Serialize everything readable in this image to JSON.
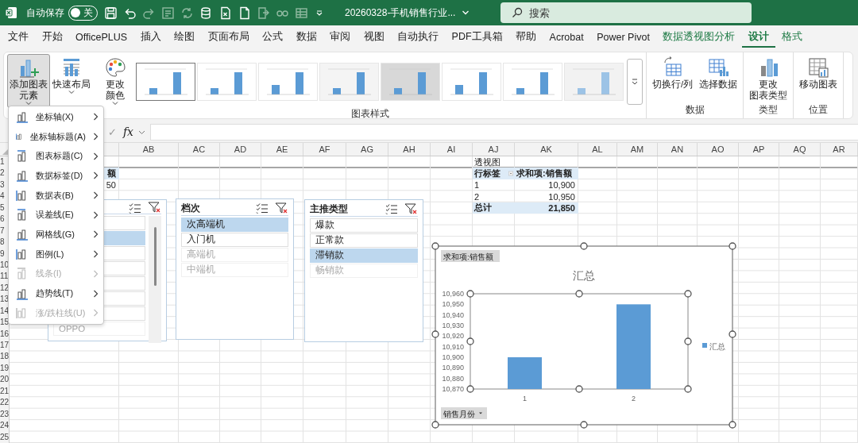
{
  "title_bar": {
    "autosave_label": "自动保存",
    "autosave": {
      "on": false,
      "label": "关"
    },
    "quick_access": [
      {
        "kind": "save",
        "disabled": false
      },
      {
        "kind": "undo",
        "disabled": false
      },
      {
        "kind": "redo",
        "disabled": true
      },
      {
        "kind": "form",
        "disabled": true
      },
      {
        "kind": "sync",
        "disabled": true
      },
      {
        "kind": "database",
        "disabled": false
      },
      {
        "kind": "spreadsheet",
        "disabled": false
      },
      {
        "kind": "file",
        "disabled": false
      },
      {
        "kind": "export",
        "disabled": true
      },
      {
        "kind": "link",
        "disabled": true
      },
      {
        "kind": "table",
        "disabled": true
      },
      {
        "kind": "customize",
        "disabled": false
      }
    ],
    "filename": "20260328-手机销售行业...",
    "search": {
      "placeholder": "搜索"
    }
  },
  "menu_tabs": [
    {
      "label": "文件",
      "selected": false,
      "contextual": false
    },
    {
      "label": "开始",
      "selected": false,
      "contextual": false
    },
    {
      "label": "OfficePLUS",
      "selected": false,
      "contextual": false
    },
    {
      "label": "插入",
      "selected": false,
      "contextual": false
    },
    {
      "label": "绘图",
      "selected": false,
      "contextual": false
    },
    {
      "label": "页面布局",
      "selected": false,
      "contextual": false
    },
    {
      "label": "公式",
      "selected": false,
      "contextual": false
    },
    {
      "label": "数据",
      "selected": false,
      "contextual": false
    },
    {
      "label": "审阅",
      "selected": false,
      "contextual": false
    },
    {
      "label": "视图",
      "selected": false,
      "contextual": false
    },
    {
      "label": "自动执行",
      "selected": false,
      "contextual": false
    },
    {
      "label": "PDF工具箱",
      "selected": false,
      "contextual": false
    },
    {
      "label": "帮助",
      "selected": false,
      "contextual": false
    },
    {
      "label": "Acrobat",
      "selected": false,
      "contextual": false
    },
    {
      "label": "Power Pivot",
      "selected": false,
      "contextual": false
    },
    {
      "label": "数据透视图分析",
      "selected": false,
      "contextual": true
    },
    {
      "label": "设计",
      "selected": true,
      "contextual": true
    },
    {
      "label": "格式",
      "selected": false,
      "contextual": true
    }
  ],
  "ribbon": {
    "layout_buttons": [
      {
        "lines": [
          "添加图表",
          "元素"
        ],
        "kind": "add-element",
        "dropdown": true,
        "pressed": true
      },
      {
        "lines": [
          "快速布局"
        ],
        "kind": "quick-layout",
        "dropdown": true,
        "pressed": false
      }
    ],
    "styles_group": {
      "label": "图表样式",
      "color_button": {
        "lines": [
          "更改",
          "颜色"
        ],
        "dropdown": true
      },
      "chart_styles": [
        {
          "selected": true
        },
        {
          "selected": false
        },
        {
          "selected": false
        },
        {
          "selected": false
        },
        {
          "selected": false
        },
        {
          "selected": false
        },
        {
          "selected": false
        },
        {
          "selected": false
        }
      ]
    },
    "groups": [
      {
        "label": "数据",
        "buttons": [
          {
            "lines": [
              "切换行/列"
            ],
            "kind": "switch"
          },
          {
            "lines": [
              "选择数据"
            ],
            "kind": "select-data"
          }
        ]
      },
      {
        "label": "类型",
        "buttons": [
          {
            "lines": [
              "更改",
              "图表类型"
            ],
            "kind": "change-type"
          }
        ]
      },
      {
        "label": "位置",
        "buttons": [
          {
            "lines": [
              "移动图表"
            ],
            "kind": "move-chart"
          }
        ]
      }
    ]
  },
  "formula_bar": {
    "enter": "✓",
    "function": "fx"
  },
  "sheet": {
    "columns": [
      "AB",
      "AC",
      "AD",
      "AE",
      "AF",
      "AG",
      "AH",
      "AI",
      "AJ",
      "AK",
      "AL",
      "AM",
      "AN",
      "AO",
      "AP",
      "AQ",
      "AR"
    ],
    "rows": [
      "1",
      "2",
      "3",
      "4",
      "5",
      "6",
      "7",
      "8",
      "9",
      "10",
      "11",
      "12",
      "13",
      "14",
      "15",
      "16",
      "17",
      "18",
      "19",
      "20",
      "21",
      "22",
      "23",
      "24",
      "25"
    ],
    "cut_cells": [
      {
        "text": "额",
        "kind": "header"
      },
      {
        "text": "50",
        "kind": "value"
      }
    ],
    "pivot_table": {
      "title": "透视图",
      "row_label": "行标签",
      "value_label": "求和项:销售额",
      "rows": [
        {
          "label": "1",
          "value": "10,900"
        },
        {
          "label": "2",
          "value": "10,950"
        }
      ],
      "total": {
        "label": "总计",
        "value": "21,850"
      }
    }
  },
  "slicers": [
    {
      "scrollbar": true,
      "items": [
        {
          "selected": false,
          "has_data": true
        },
        {
          "selected": true,
          "has_data": true
        },
        {
          "selected": false,
          "has_data": true
        },
        {
          "selected": false,
          "has_data": true
        },
        {
          "selected": false,
          "has_data": true
        },
        {
          "selected": false,
          "has_data": true
        },
        {
          "selected": false,
          "has_data": true
        },
        {
          "label": "OPPO",
          "selected": false,
          "has_data": false
        }
      ]
    },
    {
      "title": "档次",
      "scrollbar": false,
      "items": [
        {
          "label": "次高端机",
          "selected": true,
          "has_data": true
        },
        {
          "label": "入门机",
          "selected": false,
          "has_data": true
        },
        {
          "label": "高端机",
          "selected": false,
          "has_data": false
        },
        {
          "label": "中端机",
          "selected": false,
          "has_data": false
        }
      ]
    },
    {
      "title": "主推类型",
      "scrollbar": false,
      "items": [
        {
          "label": "爆款",
          "selected": false,
          "has_data": true
        },
        {
          "label": "正常款",
          "selected": false,
          "has_data": true
        },
        {
          "label": "滞销款",
          "selected": true,
          "has_data": true
        },
        {
          "label": "畅销款",
          "selected": false,
          "has_data": false
        }
      ]
    }
  ],
  "pivot_chart": {
    "value_field": "求和项:销售额",
    "axis_field": "销售月份",
    "chart_data": {
      "type": "bar",
      "title": "汇总",
      "categories": [
        "1",
        "2"
      ],
      "series": [
        {
          "name": "汇总",
          "color": "#5b9bd5",
          "values": [
            10900,
            10950
          ]
        }
      ],
      "ylim": [
        10870,
        10960
      ],
      "yticks": [
        {
          "value": 10870,
          "label": "10,870"
        },
        {
          "value": 10880,
          "label": "10,880"
        },
        {
          "value": 10890,
          "label": "10,890"
        },
        {
          "value": 10900,
          "label": "10,900"
        },
        {
          "value": 10910,
          "label": "10,910"
        },
        {
          "value": 10920,
          "label": "10,920"
        },
        {
          "value": 10930,
          "label": "10,930"
        },
        {
          "value": 10940,
          "label": "10,940"
        },
        {
          "value": 10950,
          "label": "10,950"
        },
        {
          "value": 10960,
          "label": "10,960"
        }
      ]
    }
  },
  "element_menu": [
    {
      "label": "坐标轴(X)",
      "disabled": false
    },
    {
      "label": "坐标轴标题(A)",
      "disabled": false
    },
    {
      "label": "图表标题(C)",
      "disabled": false
    },
    {
      "label": "数据标签(D)",
      "disabled": false
    },
    {
      "label": "数据表(B)",
      "disabled": false
    },
    {
      "label": "误差线(E)",
      "disabled": false
    },
    {
      "label": "网格线(G)",
      "disabled": false
    },
    {
      "label": "图例(L)",
      "disabled": false
    },
    {
      "label": "线条(I)",
      "disabled": true
    },
    {
      "label": "趋势线(T)",
      "disabled": false
    },
    {
      "label": "涨/跌柱线(U)",
      "disabled": true
    }
  ]
}
